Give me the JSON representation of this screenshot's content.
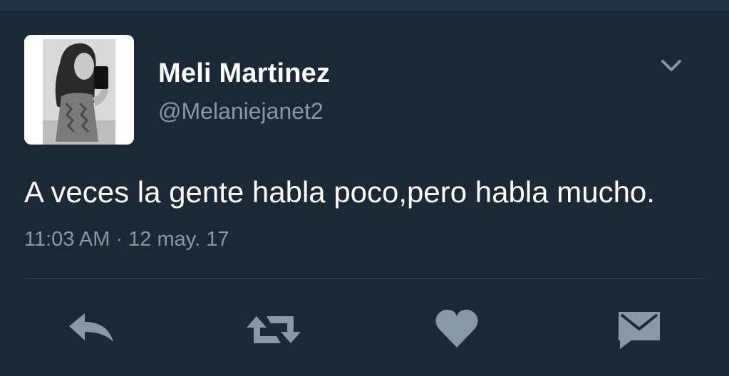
{
  "tweet": {
    "author": {
      "display_name": "Meli Martinez",
      "handle": "@Melaniejanet2",
      "avatar_icon": "profile-photo"
    },
    "menu_icon": "chevron-down-icon",
    "text": "A veces la gente habla poco,pero habla mucho.",
    "timestamp": "11:03 AM · 12 may. 17"
  },
  "actions": [
    {
      "name": "reply",
      "icon": "reply-icon"
    },
    {
      "name": "retweet",
      "icon": "retweet-icon"
    },
    {
      "name": "like",
      "icon": "heart-icon"
    },
    {
      "name": "direct-message",
      "icon": "envelope-icon"
    }
  ],
  "colors": {
    "background": "#1b2836",
    "primary_text": "#ffffff",
    "secondary_text": "#8899a6",
    "icon": "#8899a6",
    "divider": "#38444d"
  }
}
